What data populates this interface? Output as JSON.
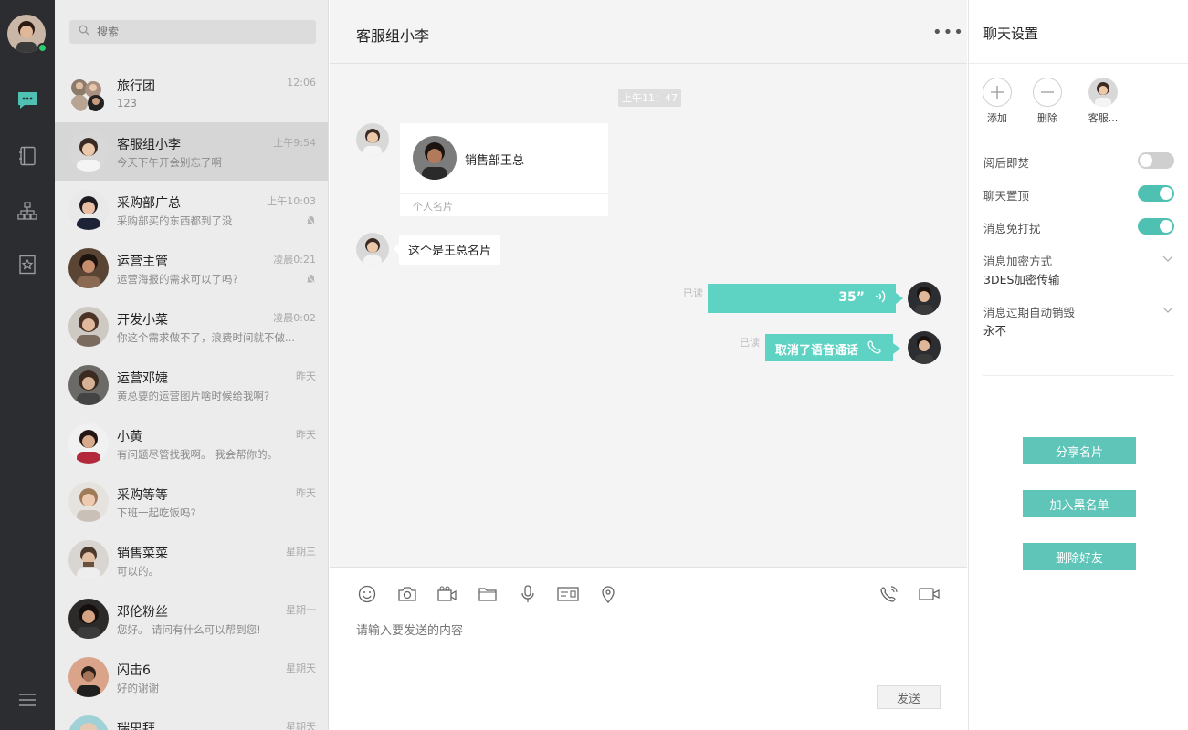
{
  "nav": {
    "icons": [
      "chat-icon",
      "notebook-icon",
      "org-chart-icon",
      "bookmark-star-icon",
      "menu-icon"
    ],
    "accent": "#4fc1b3"
  },
  "search": {
    "placeholder": "搜索"
  },
  "conversations": [
    {
      "name": "旅行团",
      "time": "12:06",
      "preview": "123",
      "muted": false
    },
    {
      "name": "客服组小李",
      "time": "上午9:54",
      "preview": "今天下午开会别忘了啊",
      "muted": false
    },
    {
      "name": "采购部广总",
      "time": "上午10:03",
      "preview": "采购部买的东西都到了没",
      "muted": true
    },
    {
      "name": "运营主管",
      "time": "凌晨0:21",
      "preview": "运营海报的需求可以了吗?",
      "muted": true
    },
    {
      "name": "开发小菜",
      "time": "凌晨0:02",
      "preview": "你这个需求做不了，浪费时间就不做...",
      "muted": false
    },
    {
      "name": "运营邓婕",
      "time": "昨天",
      "preview": "黄总要的运营图片啥时候给我啊?",
      "muted": false
    },
    {
      "name": "小黄",
      "time": "昨天",
      "preview": "有问题尽管找我啊。 我会帮你的。",
      "muted": false
    },
    {
      "name": "采购等等",
      "time": "昨天",
      "preview": "下班一起吃饭吗?",
      "muted": false
    },
    {
      "name": "销售菜菜",
      "time": "星期三",
      "preview": "可以的。",
      "muted": false
    },
    {
      "name": "邓伦粉丝",
      "time": "星期一",
      "preview": "您好。 请问有什么可以帮到您!",
      "muted": false
    },
    {
      "name": "闪击6",
      "time": "星期天",
      "preview": "好的谢谢",
      "muted": false
    },
    {
      "name": "瑞思拜",
      "time": "星期天",
      "preview": "",
      "muted": false
    }
  ],
  "chat": {
    "title": "客服组小李",
    "more": "•••",
    "time_divider": "上午11：47",
    "card": {
      "name": "销售部王总",
      "footer": "个人名片"
    },
    "text_message": "这个是王总名片",
    "voice": {
      "read": "已读",
      "duration": "35”"
    },
    "call": {
      "read": "已读",
      "text": "取消了语音通话"
    },
    "input_placeholder": "请输入要发送的内容",
    "send_label": "发送"
  },
  "settings": {
    "title": "聊天设置",
    "members": [
      {
        "label": "添加",
        "icon": "plus-icon"
      },
      {
        "label": "删除",
        "icon": "minus-icon"
      },
      {
        "label": "客服...",
        "icon": "avatar"
      }
    ],
    "burn_after_read": {
      "label": "阅后即焚",
      "on": false
    },
    "pin_chat": {
      "label": "聊天置顶",
      "on": true
    },
    "do_not_disturb": {
      "label": "消息免打扰",
      "on": true
    },
    "encryption": {
      "label": "消息加密方式",
      "value": "3DES加密传输"
    },
    "auto_destroy": {
      "label": "消息过期自动销毁",
      "value": "永不"
    },
    "actions": {
      "share": "分享名片",
      "blacklist": "加入黑名单",
      "delete": "删除好友"
    }
  }
}
